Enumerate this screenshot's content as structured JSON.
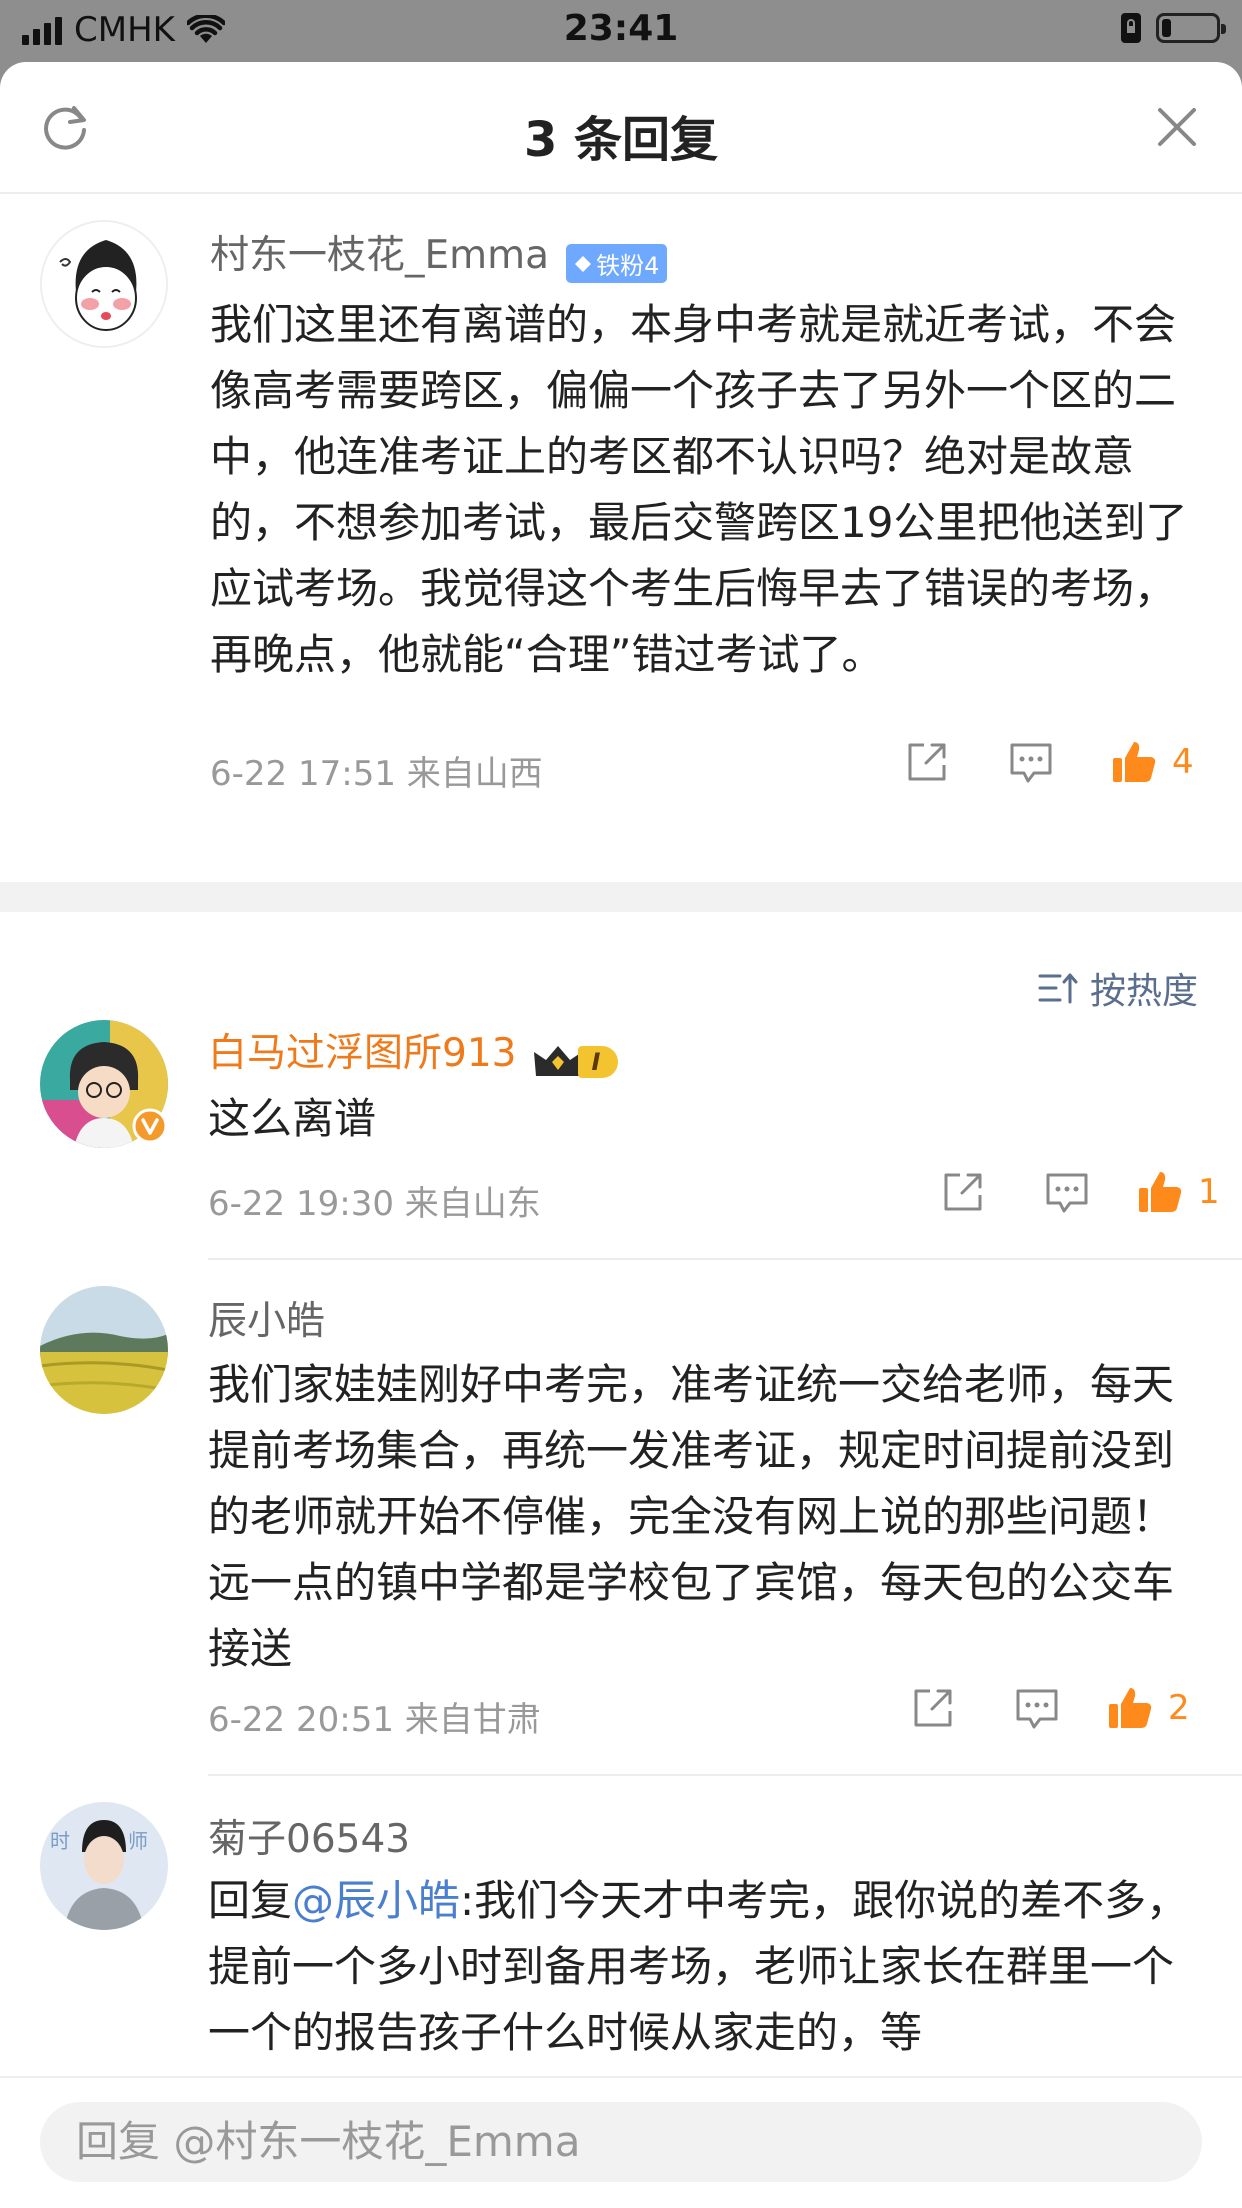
{
  "status": {
    "carrier": "CMHK",
    "time": "23:41"
  },
  "header": {
    "title": "3 条回复"
  },
  "root": {
    "name": "村东一枝花_Emma",
    "fan_badge": "铁粉4",
    "text": "我们这里还有离谱的，本身中考就是就近考试，不会像高考需要跨区，偏偏一个孩子去了另外一个区的二中，他连准考证上的考区都不认识吗？绝对是故意的，不想参加考试，最后交警跨区19公里把他送到了应试考场。我觉得这个考生后悔早去了错误的考场，再晚点，他就能“合理”错过考试了。",
    "meta": "6-22 17:51  来自山西",
    "likes": "4"
  },
  "sort": {
    "label": "按热度"
  },
  "comments": [
    {
      "name": "白马过浮图所913",
      "vip": "I",
      "text": "这么离谱",
      "meta": "6-22 19:30  来自山东",
      "likes": "1"
    },
    {
      "name": "辰小皓",
      "text": "我们家娃娃刚好中考完，准考证统一交给老师，每天提前考场集合，再统一发准考证，规定时间提前没到的老师就开始不停催，完全没有网上说的那些问题！远一点的镇中学都是学校包了宾馆，每天包的公交车接送",
      "meta": "6-22 20:51  来自甘肃",
      "likes": "2"
    },
    {
      "name": "菊子06543",
      "reply_prefix": "回复",
      "mention": "@辰小皓",
      "text": ":我们今天才中考完，跟你说的差不多，提前一个多小时到备用考场，老师让家长在群里一个一个的报告孩子什么时候从家走的，等"
    }
  ],
  "input": {
    "placeholder": "回复 @村东一枝花_Emma"
  },
  "colors": {
    "accent_orange": "#ff8a1c",
    "name_orange": "#f07a1a",
    "link_blue": "#4a7fd0",
    "fan_badge": "#6fa8ff"
  }
}
